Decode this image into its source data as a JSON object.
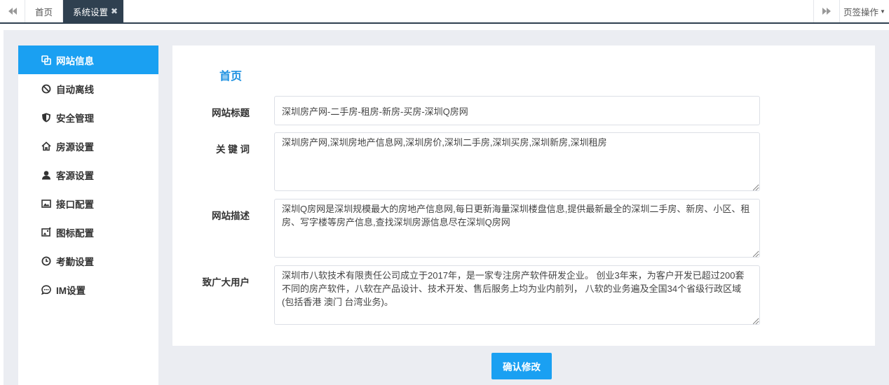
{
  "tabs": {
    "prev_icon": "double-left-icon",
    "home_label": "首页",
    "active_label": "系统设置",
    "close_glyph": "✖",
    "next_icon": "double-right-icon",
    "ops_label": "页签操作"
  },
  "sidebar": {
    "items": [
      {
        "label": "网站信息",
        "icon": "website-info-icon",
        "active": true
      },
      {
        "label": "自动离线",
        "icon": "ban-icon",
        "active": false
      },
      {
        "label": "安全管理",
        "icon": "shield-icon",
        "active": false
      },
      {
        "label": "房源设置",
        "icon": "home-icon",
        "active": false
      },
      {
        "label": "客源设置",
        "icon": "user-icon",
        "active": false
      },
      {
        "label": "接口配置",
        "icon": "interface-image-icon",
        "active": false
      },
      {
        "label": "图标配置",
        "icon": "image-config-icon",
        "active": false
      },
      {
        "label": "考勤设置",
        "icon": "clock-icon",
        "active": false
      },
      {
        "label": "IM设置",
        "icon": "chat-icon",
        "active": false
      }
    ]
  },
  "form": {
    "title": "首页",
    "site_title_label": "网站标题",
    "site_title_value": "深圳房产网-二手房-租房-新房-买房-深圳Q房网",
    "keywords_label": "关 键 词",
    "keywords_value": "深圳房产网,深圳房地产信息网,深圳房价,深圳二手房,深圳买房,深圳新房,深圳租房",
    "description_label": "网站描述",
    "description_value": "深圳Q房网是深圳规模最大的房地产信息网,每日更新海量深圳楼盘信息,提供最新最全的深圳二手房、新房、小区、租房、写字楼等房产信息,查找深圳房源信息尽在深圳Q房网",
    "users_label": "致广大用户",
    "users_value": "深圳市八软技术有限责任公司成立于2017年，是一家专注房产软件研发企业。 创业3年来，为客户开发已超过200套不同的房产软件，八软在产品设计、技术开发、售后服务上均为业内前列， 八软的业务遍及全国34个省级行政区域(包括香港 澳门 台湾业务)。",
    "submit_label": "确认修改"
  },
  "colors": {
    "accent": "#1aa0f2",
    "tab_dark": "#2f4050",
    "background": "#ebedf2"
  }
}
